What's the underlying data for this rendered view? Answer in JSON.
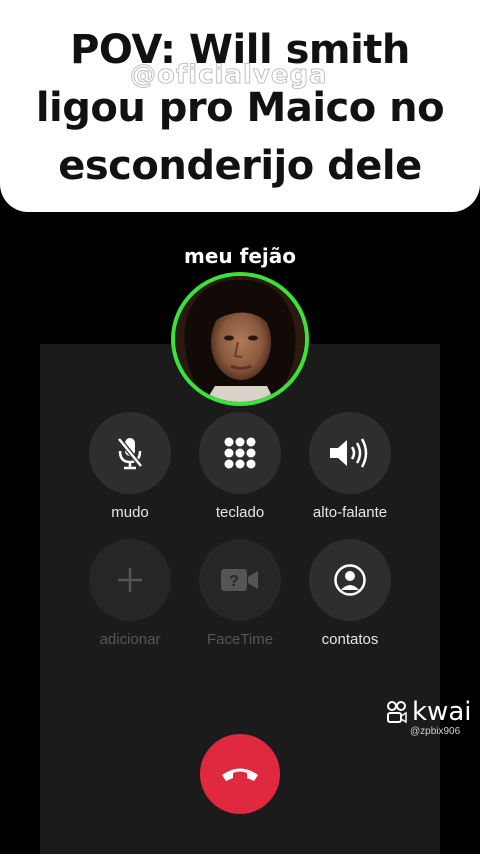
{
  "caption": {
    "lines": [
      "POV: Will smith",
      "ligou pro Maico no",
      "esconderijo dele"
    ],
    "watermark": "@oficialvega"
  },
  "call": {
    "contact_name": "meu fejão",
    "buttons": [
      {
        "label": "mudo",
        "icon": "mic-off-icon",
        "enabled": true
      },
      {
        "label": "teclado",
        "icon": "keypad-icon",
        "enabled": true
      },
      {
        "label": "alto-falante",
        "icon": "speaker-icon",
        "enabled": true
      },
      {
        "label": "adicionar",
        "icon": "plus-icon",
        "enabled": false
      },
      {
        "label": "FaceTime",
        "icon": "facetime-icon",
        "enabled": false
      },
      {
        "label": "contatos",
        "icon": "contacts-icon",
        "enabled": true
      }
    ],
    "end_call_icon": "phone-hangup-icon"
  },
  "kwai": {
    "brand": "kwai",
    "handle": "@zpbix906"
  },
  "colors": {
    "avatar_ring": "#3ae23a",
    "end_call": "#e0283f",
    "panel": "#1b1b1b"
  }
}
